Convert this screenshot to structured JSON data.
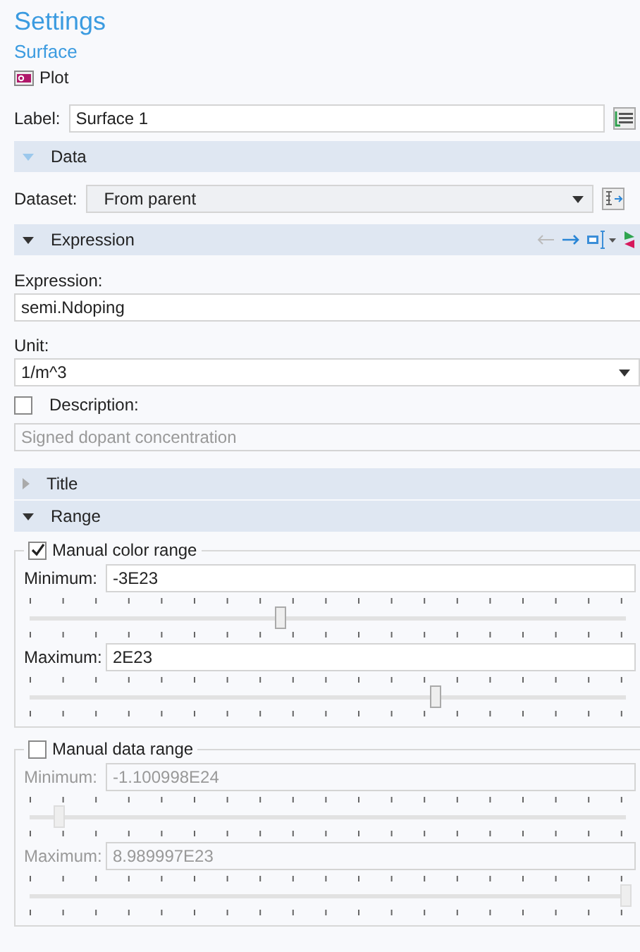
{
  "header": {
    "title": "Settings",
    "subtitle": "Surface",
    "node": "Plot"
  },
  "label_field": {
    "label": "Label:",
    "value": "Surface 1"
  },
  "sections": [
    {
      "kind": "data",
      "title": "Data",
      "expanded": true,
      "dataset_label": "Dataset:",
      "dataset_value": "From parent"
    },
    {
      "kind": "expression",
      "title": "Expression",
      "expanded": true,
      "expression_label": "Expression:",
      "expression_value": "semi.Ndoping",
      "unit_label": "Unit:",
      "unit_value": "1/m^3",
      "description_label": "Description:",
      "description_checked": false,
      "description_value": "Signed dopant concentration"
    },
    {
      "kind": "title",
      "title": "Title",
      "expanded": false
    },
    {
      "kind": "range",
      "title": "Range",
      "expanded": true,
      "groups": [
        {
          "label": "Manual color range",
          "checked": true,
          "fields": [
            {
              "label": "Minimum:",
              "value": "-3E23",
              "level": 0.42
            },
            {
              "label": "Maximum:",
              "value": "2E23",
              "level": 0.68
            }
          ]
        },
        {
          "label": "Manual data range",
          "checked": false,
          "fields": [
            {
              "label": "Minimum:",
              "value": "-1.100998E24",
              "level": 0.05
            },
            {
              "label": "Maximum:",
              "value": "8.989997E23",
              "level": 1.0
            }
          ]
        }
      ]
    }
  ]
}
